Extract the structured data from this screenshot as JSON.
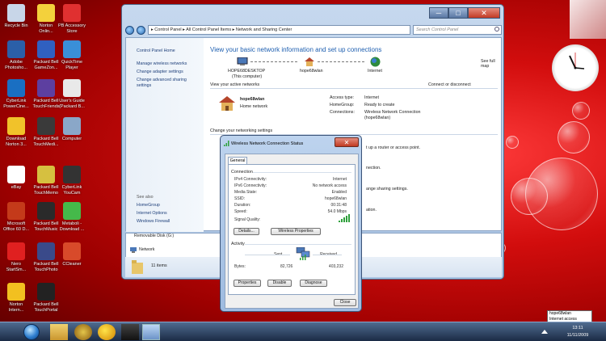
{
  "desktop_icons": [
    {
      "label": "Recycle Bin",
      "color": "#c8d6e8"
    },
    {
      "label": "Norton Onlin...",
      "color": "#f3d13c"
    },
    {
      "label": "PB Accessory Store",
      "color": "#e03030"
    },
    {
      "label": "Adobe Photosho...",
      "color": "#2b5fa8"
    },
    {
      "label": "Packard Bell GameZon...",
      "color": "#3060c0"
    },
    {
      "label": "QuickTime Player",
      "color": "#3a8fd8"
    },
    {
      "label": "CyberLink PowerCine...",
      "color": "#1a6fc2"
    },
    {
      "label": "Packard Bell TouchFriends",
      "color": "#5d3fa0"
    },
    {
      "label": "User's Guide (Packard B...",
      "color": "#e9e9e9"
    },
    {
      "label": "Download Norton 3...",
      "color": "#f1c22a"
    },
    {
      "label": "Packard Bell TouchMedi...",
      "color": "#3a3a3a"
    },
    {
      "label": "Computer",
      "color": "#8aa7c8"
    },
    {
      "label": "eBay",
      "color": "#ffffff"
    },
    {
      "label": "Packard Bell TouchMemo",
      "color": "#d6c040"
    },
    {
      "label": "CyberLink YouCam",
      "color": "#333333"
    },
    {
      "label": "Microsoft Office 60 D...",
      "color": "#c43a1a"
    },
    {
      "label": "Packard Bell TouchMusic",
      "color": "#2a2a2a"
    },
    {
      "label": "Metaboli - Download ...",
      "color": "#45b94a"
    },
    {
      "label": "Nero StartSm...",
      "color": "#e02020"
    },
    {
      "label": "Packard Bell TouchPhoto",
      "color": "#3a4a8a"
    },
    {
      "label": "CCleaner",
      "color": "#d84a2a"
    },
    {
      "label": "Norton Intern...",
      "color": "#f2c020"
    },
    {
      "label": "Packard Bell TouchPortal",
      "color": "#222222"
    }
  ],
  "explorer": {
    "breadcrumb": "▸ Control Panel ▸ All Control Panel Items ▸ Network and Sharing Center",
    "search_placeholder": "Search Control Panel",
    "minimize": "─",
    "maximize": "□",
    "close": "✕",
    "left_links": [
      "Control Panel Home",
      "Manage wireless networks",
      "Change adapter settings",
      "Change advanced sharing",
      "settings"
    ],
    "see_also_title": "See also",
    "see_also": [
      "HomeGroup",
      "Internet Options",
      "Windows Firewall"
    ],
    "title": "View your basic network information and set up connections",
    "see_full_map": "See full map",
    "map_computer": "HOPE68DESKTOP",
    "map_computer_sub": "(This computer)",
    "map_network": "hope68wlan",
    "map_internet": "Internet",
    "active_networks_label": "View your active networks",
    "connect_disconnect": "Connect or disconnect",
    "network_name": "hope68wlan",
    "network_type": "Home network",
    "access_type_label": "Access type:",
    "access_type_value": "Internet",
    "homegroup_label": "HomeGroup:",
    "homegroup_value": "Ready to create",
    "connections_label": "Connections:",
    "connections_value": "Wireless Network Connection",
    "connections_value2": "(hope68wlan)",
    "change_settings": "Change your networking settings",
    "frag1": "t up a router or access point.",
    "frag2": "nection.",
    "frag3": "ange sharing settings.",
    "frag4": "ation.",
    "removable_disk": "Removable Disk (G:)",
    "network_nav": "Network",
    "items_count": "11 items"
  },
  "dialog": {
    "title": "Wireless Network Connection Status",
    "tab_general": "General",
    "connection_title": "Connection",
    "rows": [
      {
        "label": "IPv4 Connectivity:",
        "value": "Internet"
      },
      {
        "label": "IPv6 Connectivity:",
        "value": "No network access"
      },
      {
        "label": "Media State:",
        "value": "Enabled"
      },
      {
        "label": "SSID:",
        "value": "hope68wlan"
      },
      {
        "label": "Duration:",
        "value": "00:31:48"
      },
      {
        "label": "Speed:",
        "value": "54.0 Mbps"
      }
    ],
    "signal_quality": "Signal Quality:",
    "signal_bars": 5,
    "details_button": "Details...",
    "wireless_properties_button": "Wireless Properties",
    "activity_title": "Activity",
    "sent_label": "Sent",
    "received_label": "Received",
    "bytes_label": "Bytes:",
    "bytes_sent": "82,726",
    "bytes_received": "403,232",
    "properties_button": "Properties",
    "disable_button": "Disable",
    "diagnose_button": "Diagnose",
    "close_button": "Close"
  },
  "taskbar": {
    "time": "13:11",
    "date": "11/11/2009",
    "tooltip_line1": "hope68wlan",
    "tooltip_line2": "Internet access"
  }
}
